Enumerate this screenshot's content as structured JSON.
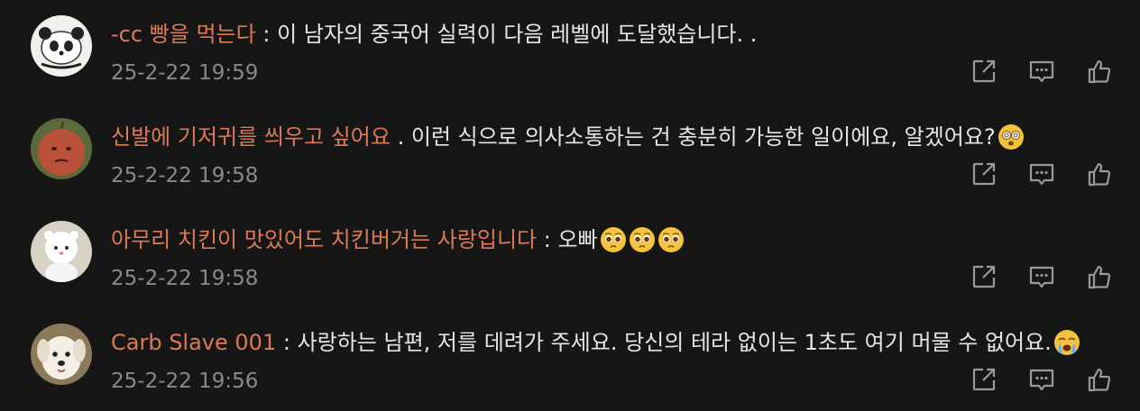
{
  "comments": [
    {
      "author": "-cc 빵을 먹는다",
      "separator": " : ",
      "text": "이 남자의 중국어 실력이 다음 레벨에 도달했습니다. .",
      "emojis": [],
      "time": "25-2-22 19:59",
      "avatar": "panda-avatar"
    },
    {
      "author": "신발에 기저귀를 씌우고 싶어요",
      "separator": " . ",
      "text": "이런 식으로 의사소통하는 건 충분히 가능한 일이에요, 알겠어요?",
      "emojis": [
        "dizzy-face-emoji"
      ],
      "time": "25-2-22 19:58",
      "avatar": "apple-face-avatar"
    },
    {
      "author": "아무리 치킨이 맛있어도 치킨버거는 사랑입니다",
      "separator": " : ",
      "text": "오빠",
      "emojis": [
        "pleading-face-emoji",
        "pleading-face-emoji",
        "pleading-face-emoji"
      ],
      "time": "25-2-22 19:58",
      "avatar": "white-bear-avatar"
    },
    {
      "author": "Carb Slave 001",
      "separator": " : ",
      "text": "사랑하는 남편, 저를 데려가 주세요. 당신의 테라 없이는 1초도 여기 머물 수 없어요.",
      "emojis": [
        "crying-face-emoji"
      ],
      "time": "25-2-22 19:56",
      "avatar": "puppy-avatar"
    }
  ],
  "actions": [
    "share-icon",
    "comment-icon",
    "like-icon"
  ],
  "colors": {
    "background": "#161616",
    "author": "#dd7a55",
    "text": "#e6e6e6",
    "time": "#8a8a8a",
    "icon": "#9a9a9a"
  }
}
